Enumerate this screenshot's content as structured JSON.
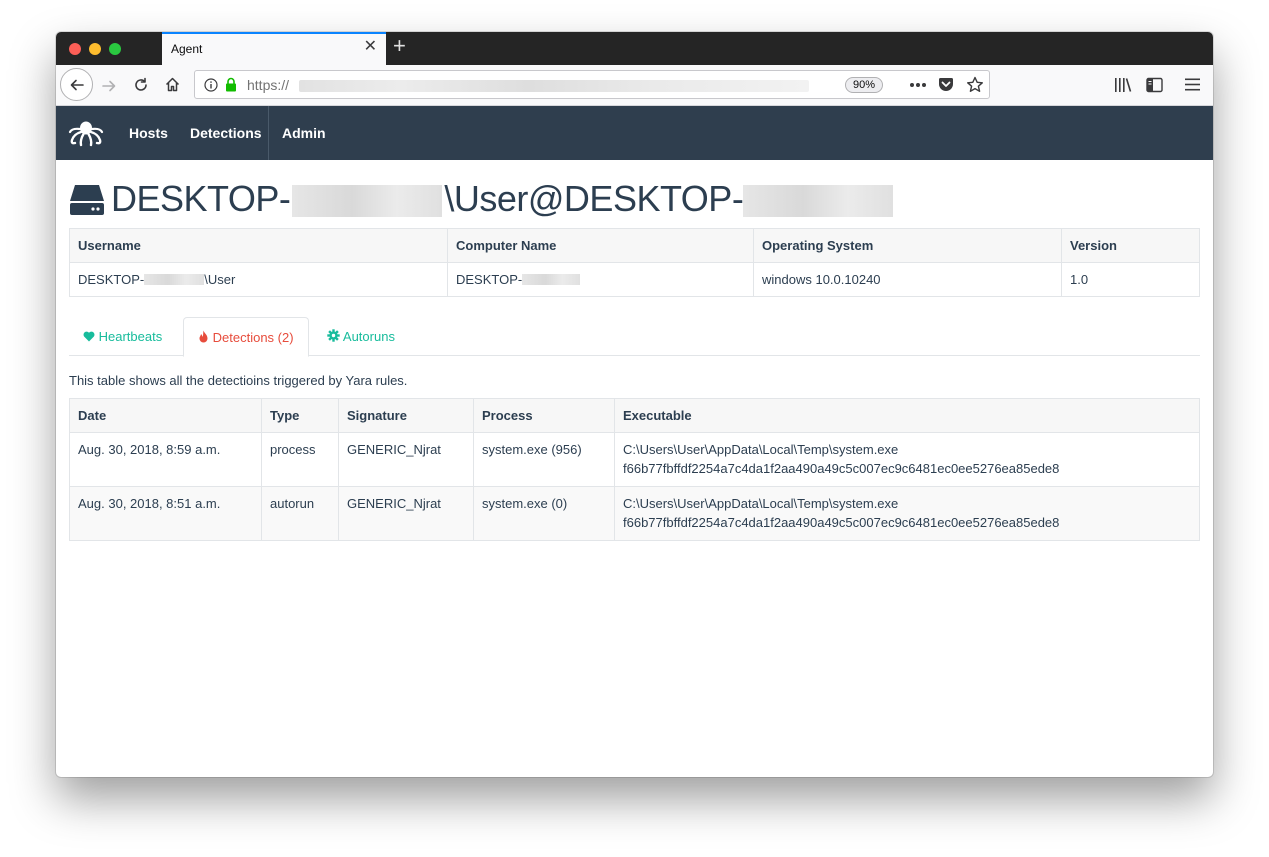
{
  "browser": {
    "tab_title": "Agent",
    "tab_close": "✕",
    "new_tab": "+",
    "url_prefix": "https://",
    "zoom": "90%"
  },
  "navbar": {
    "items": [
      {
        "label": "Hosts"
      },
      {
        "label": "Detections"
      },
      {
        "label": "Admin"
      }
    ]
  },
  "header": {
    "title_part1": "DESKTOP-",
    "title_part2": "\\User@DESKTOP-"
  },
  "host_info": {
    "columns": [
      "Username",
      "Computer Name",
      "Operating System",
      "Version"
    ],
    "username_prefix": "DESKTOP-",
    "username_suffix": "\\User",
    "computer_prefix": "DESKTOP-",
    "os": "windows 10.0.10240",
    "version": "1.0"
  },
  "tabs": [
    {
      "label": "Heartbeats",
      "icon": "heart-icon",
      "color": "#18bc9c"
    },
    {
      "label": "Detections (2)",
      "icon": "fire-icon",
      "color": "#e74c3c"
    },
    {
      "label": "Autoruns",
      "icon": "gear-icon",
      "color": "#18bc9c"
    }
  ],
  "description": "This table shows all the detectioins triggered by Yara rules.",
  "detections": {
    "columns": [
      "Date",
      "Type",
      "Signature",
      "Process",
      "Executable"
    ],
    "rows": [
      {
        "date": "Aug. 30, 2018, 8:59 a.m.",
        "type": "process",
        "signature": "GENERIC_Njrat",
        "process": "system.exe (956)",
        "exe_path": "C:\\Users\\User\\AppData\\Local\\Temp\\system.exe",
        "exe_hash": "f66b77fbffdf2254a7c4da1f2aa490a49c5c007ec9c6481ec0ee5276ea85ede8"
      },
      {
        "date": "Aug. 30, 2018, 8:51 a.m.",
        "type": "autorun",
        "signature": "GENERIC_Njrat",
        "process": "system.exe (0)",
        "exe_path": "C:\\Users\\User\\AppData\\Local\\Temp\\system.exe",
        "exe_hash": "f66b77fbffdf2254a7c4da1f2aa490a49c5c007ec9c6481ec0ee5276ea85ede8"
      }
    ]
  },
  "colors": {
    "navbar": "#2f3e4e",
    "accent": "#18bc9c",
    "danger": "#e74c3c",
    "text": "#2c3e50"
  }
}
